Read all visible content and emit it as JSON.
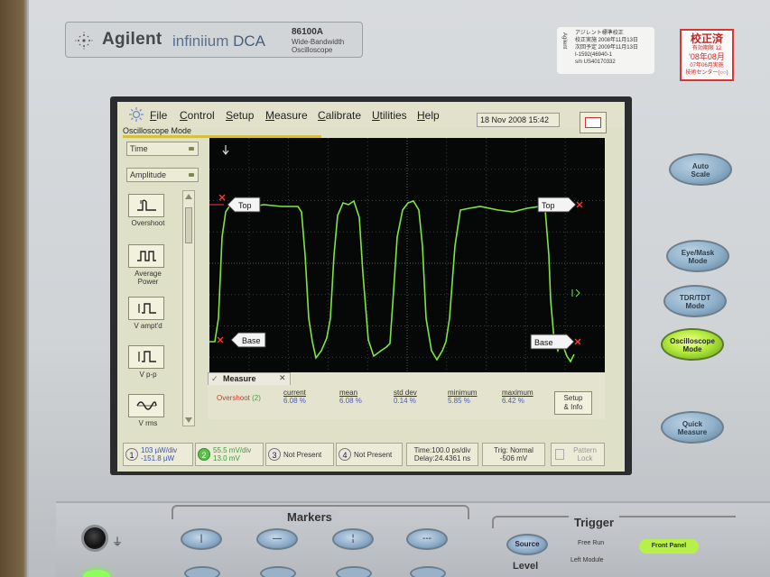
{
  "instrument": {
    "brand": "Agilent",
    "product_line_1": "infiniium",
    "product_line_2": "DCA",
    "model": "86100A",
    "model_desc_1": "Wide-Bandwidth",
    "model_desc_2": "Oscilloscope"
  },
  "calibration_label": {
    "vertical": "Agilent",
    "line1": "アジレント標準校正",
    "line2": "校正実施  2008年11月13日",
    "line3": "次回予定  2009年11月13日",
    "line4": "I-1592(46940-1",
    "line5": "s/n  US40170332"
  },
  "sticker": {
    "title": "校正済",
    "line1": "有効期限 12",
    "line2": "'08年08月",
    "line3": "07年06月実施",
    "line4": "技術センター(○○)"
  },
  "menu": {
    "file": "File",
    "control": "Control",
    "setup": "Setup",
    "measure": "Measure",
    "calibrate": "Calibrate",
    "utilities": "Utilities",
    "help": "Help",
    "datetime": "18 Nov 2008   15:42"
  },
  "mode_label": "Oscilloscope Mode",
  "left_panel": {
    "dropdown_time": "Time",
    "dropdown_amplitude": "Amplitude",
    "items": [
      {
        "label": "Overshoot"
      },
      {
        "label": "Average\nPower"
      },
      {
        "label": "V ampt'd"
      },
      {
        "label": "V p-p"
      },
      {
        "label": "V rms"
      }
    ]
  },
  "plot": {
    "top_label_left": "Top",
    "top_label_right": "Top",
    "base_label_left": "Base",
    "base_label_right": "Base",
    "trace_color": "#7fe640",
    "marker_color": "#ff3a28"
  },
  "measure_panel": {
    "tab": "Measure",
    "name": "Overshoot",
    "channel": "(2)",
    "headers": [
      "current",
      "mean",
      "std dev",
      "minimum",
      "maximum"
    ],
    "values": [
      "6.08 %",
      "6.08 %",
      "0.14 %",
      "5.85 %",
      "6.42 %"
    ],
    "setup_btn_1": "Setup",
    "setup_btn_2": "& Info"
  },
  "status": {
    "ch1_num": "1",
    "ch1_l1": "103 µW/div",
    "ch1_l2": "-151.8 µW",
    "ch2_num": "2",
    "ch2_l1": "55.5 mV/div",
    "ch2_l2": "13.0 mV",
    "ch3_num": "3",
    "ch3_label": "Not Present",
    "ch4_num": "4",
    "ch4_label": "Not Present",
    "time_l1": "Time:100.0 ps/div",
    "time_l2": "Delay:24.4361 ns",
    "trig_l1": "Trig: Normal",
    "trig_l2": "-506 mV",
    "pattern_l1": "Pattern",
    "pattern_l2": "Lock"
  },
  "right_buttons": {
    "auto_scale_1": "Auto",
    "auto_scale_2": "Scale",
    "eye_1": "Eye/Mask",
    "eye_2": "Mode",
    "tdr_1": "TDR/TDT",
    "tdr_2": "Mode",
    "osc_1": "Oscilloscope",
    "osc_2": "Mode",
    "quick_1": "Quick",
    "quick_2": "Measure"
  },
  "front_panel": {
    "markers": "Markers",
    "trigger": "Trigger",
    "marker_btn_1": "|",
    "marker_btn_2": "—",
    "marker_btn_3": "¦",
    "marker_btn_4": "---",
    "source": "Source",
    "free_run": "Free Run",
    "left_module": "Left Module",
    "level": "Level",
    "front_panel_btn": "Front Panel"
  }
}
